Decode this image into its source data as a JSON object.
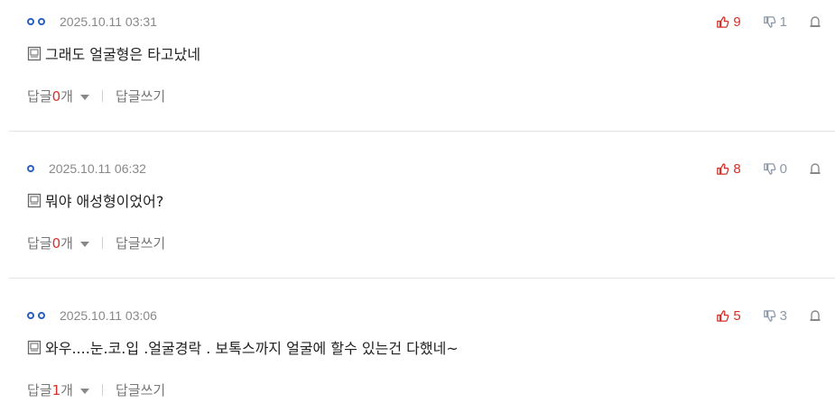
{
  "comments": [
    {
      "date": "2025.10.11 03:31",
      "likes": "9",
      "dislikes": "1",
      "text": "그래도 얼굴형은 타고났네",
      "reply_label": "답글 ",
      "reply_count": "0",
      "reply_suffix": "개",
      "write_reply": "답글쓰기"
    },
    {
      "date": "2025.10.11 06:32",
      "likes": "8",
      "dislikes": "0",
      "text": "뭐야 애성형이었어?",
      "reply_label": "답글 ",
      "reply_count": "0",
      "reply_suffix": "개",
      "write_reply": "답글쓰기"
    },
    {
      "date": "2025.10.11 03:06",
      "likes": "5",
      "dislikes": "3",
      "text": "와우....눈.코.입 .얼굴경락 . 보톡스까지 얼굴에 할수 있는건 다했네~",
      "reply_label": "답글 ",
      "reply_count": "1",
      "reply_suffix": "개",
      "write_reply": "답글쓰기"
    }
  ],
  "colors": {
    "like": "#d6302a",
    "dislike": "#8c98a8",
    "nickname_dot": "#2b5fbf",
    "reply_count": "#d6302a"
  },
  "icons": {
    "like": "thumbs-up-icon",
    "dislike": "thumbs-down-icon",
    "report": "report-icon",
    "memo": "memo-icon",
    "toggle": "chevron-down-icon"
  }
}
